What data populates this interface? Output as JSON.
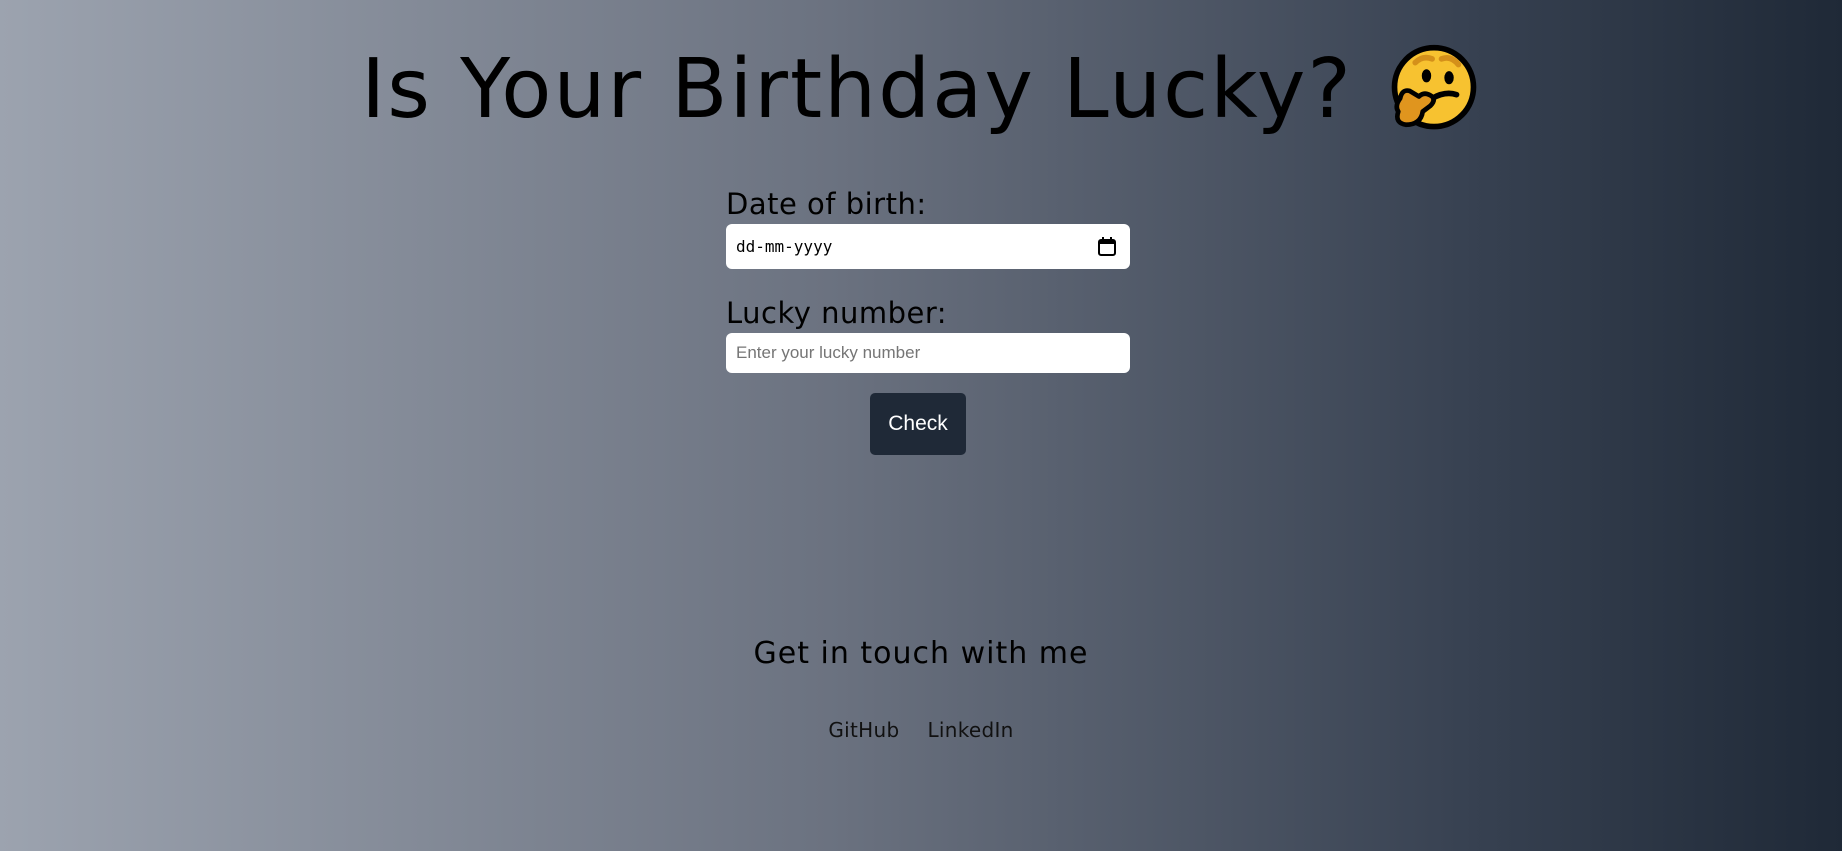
{
  "header": {
    "title": "Is Your Birthday Lucky?",
    "emoji_icon": "thinking-face-icon"
  },
  "form": {
    "dob_label": "Date of birth:",
    "dob_placeholder": "dd-mm-yyyy",
    "lucky_label": "Lucky number:",
    "lucky_placeholder": "Enter your lucky number",
    "check_label": "Check"
  },
  "footer": {
    "contact_title": "Get in touch with me",
    "links": [
      "GitHub",
      "LinkedIn"
    ]
  },
  "colors": {
    "gradient_start": "#9ca3af",
    "gradient_end": "#1f2937",
    "button_bg": "#1f2937",
    "button_text": "#ffffff"
  }
}
